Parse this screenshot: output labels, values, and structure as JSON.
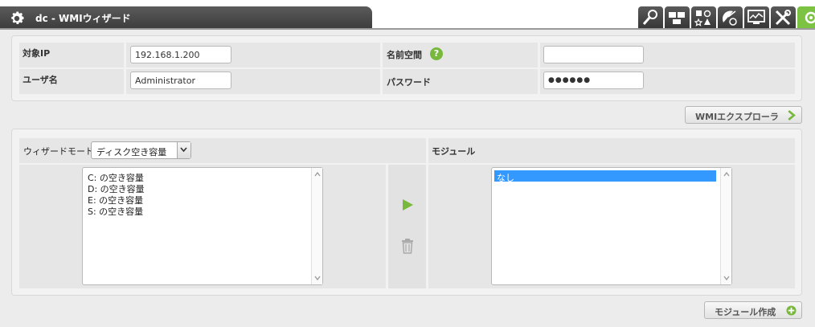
{
  "header": {
    "title": "dc - WMIウィザード",
    "tool_icons": [
      "wrench-magnify-icon",
      "network-icon",
      "shapes-icon",
      "satellite-icon",
      "monitor-chart-icon",
      "tools-icon",
      "eye-icon"
    ]
  },
  "form": {
    "target_ip_label": "対象IP",
    "target_ip_value": "192.168.1.200",
    "namespace_label": "名前空間",
    "namespace_value": "",
    "username_label": "ユーザ名",
    "username_value": "Administrator",
    "password_label": "パスワード",
    "password_value": "●●●●●●"
  },
  "wmi_explorer_button": "WMIエクスプローラ",
  "wizard": {
    "mode_label": "ウィザードモード :",
    "mode_value": "ディスク空き容量",
    "modules_header": "モジュール",
    "available_items": [
      "C: の空き容量",
      "D: の空き容量",
      "E: の空き容量",
      "S: の空き容量"
    ],
    "module_items": [
      "なし"
    ]
  },
  "create_module_button": "モジュール作成",
  "colors": {
    "accent_green": "#78b83c",
    "selection_blue": "#3399ff",
    "header_dark": "#3c3c3c"
  }
}
